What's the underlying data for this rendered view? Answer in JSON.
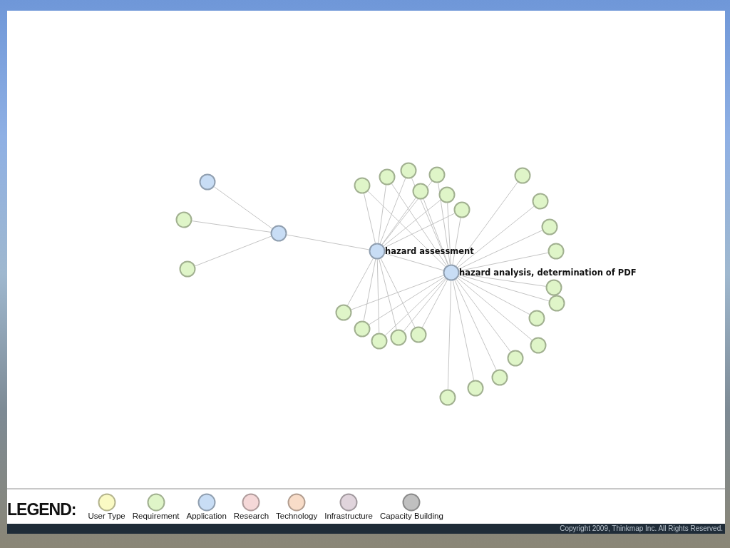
{
  "graph": {
    "nodes": [
      {
        "kind": "application"
      },
      {
        "kind": "requirement"
      },
      {
        "kind": "requirement"
      },
      {
        "kind": "application"
      },
      {
        "kind": "application",
        "label": "hazard assessment"
      },
      {
        "kind": "application",
        "label": "hazard analysis, determination of PDF"
      },
      {
        "kind": "requirement"
      },
      {
        "kind": "requirement"
      },
      {
        "kind": "requirement"
      },
      {
        "kind": "requirement"
      },
      {
        "kind": "requirement"
      },
      {
        "kind": "requirement"
      },
      {
        "kind": "requirement"
      },
      {
        "kind": "requirement"
      },
      {
        "kind": "requirement"
      },
      {
        "kind": "requirement"
      },
      {
        "kind": "requirement"
      },
      {
        "kind": "requirement"
      },
      {
        "kind": "requirement"
      },
      {
        "kind": "requirement"
      },
      {
        "kind": "requirement"
      },
      {
        "kind": "requirement"
      },
      {
        "kind": "requirement"
      },
      {
        "kind": "requirement"
      },
      {
        "kind": "requirement"
      },
      {
        "kind": "requirement"
      },
      {
        "kind": "requirement"
      },
      {
        "kind": "requirement"
      },
      {
        "kind": "requirement"
      },
      {
        "kind": "requirement"
      }
    ]
  },
  "legend": {
    "title": "LEGEND:",
    "items": [
      {
        "kind": "user_type",
        "label": "User Type",
        "color": "#fafac4"
      },
      {
        "kind": "requirement",
        "label": "Requirement",
        "color": "#dff5c8"
      },
      {
        "kind": "application",
        "label": "Application",
        "color": "#c8ddf5"
      },
      {
        "kind": "research",
        "label": "Research",
        "color": "#f5d8d8"
      },
      {
        "kind": "technology",
        "label": "Technology",
        "color": "#f8dcc8"
      },
      {
        "kind": "infrastructure",
        "label": "Infrastructure",
        "color": "#e0d4dc"
      },
      {
        "kind": "capacity_building",
        "label": "Capacity Building",
        "color": "#c0c0c0"
      }
    ]
  },
  "footer": {
    "copyright": "Copyright 2009, Thinkmap Inc. All Rights Reserved."
  }
}
